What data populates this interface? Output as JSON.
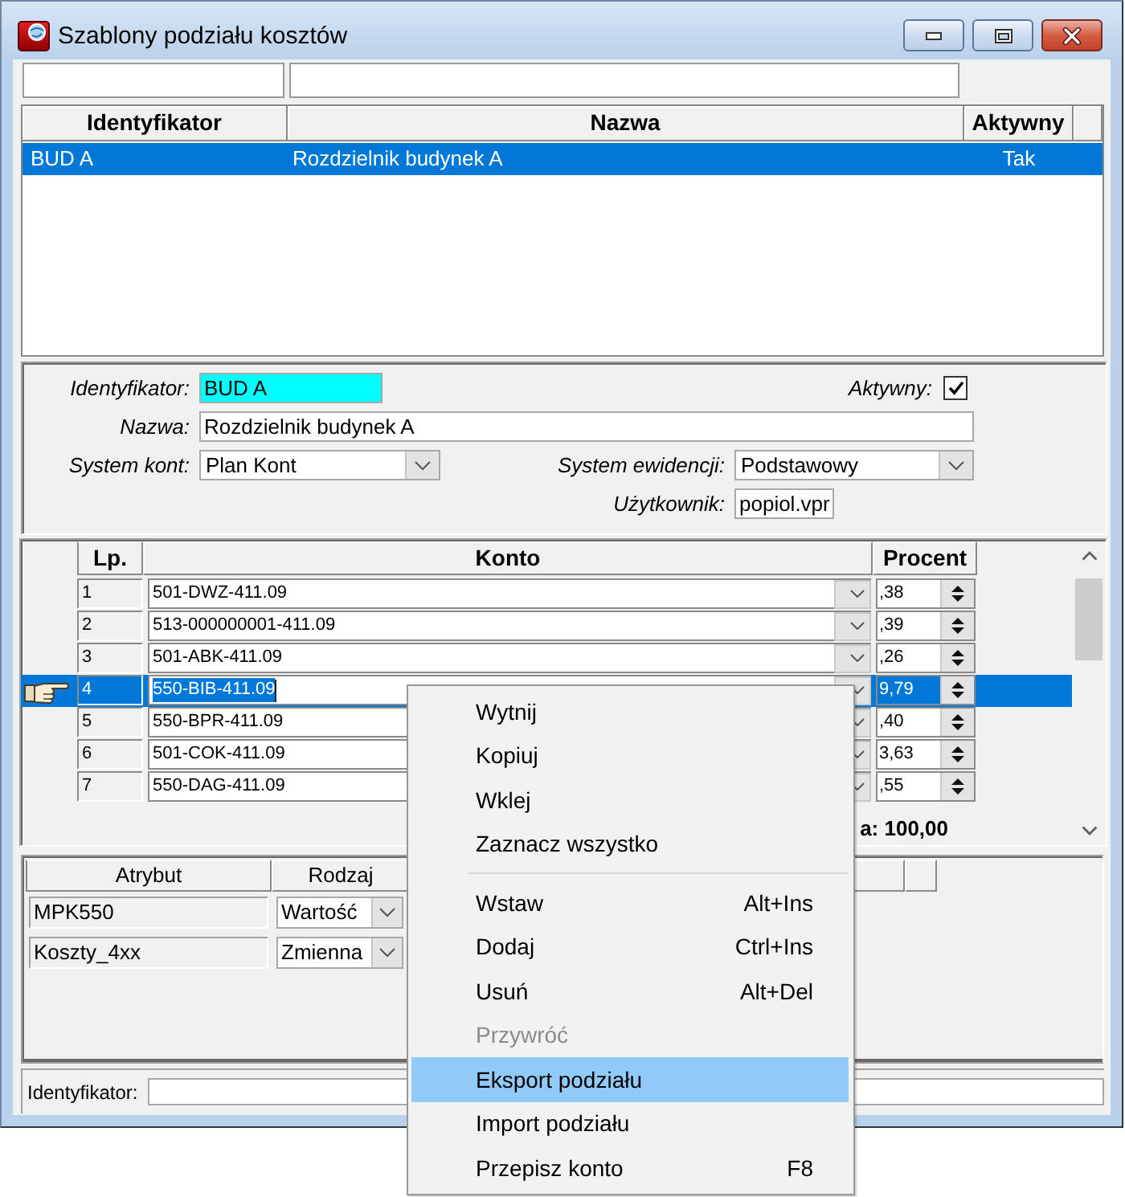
{
  "window": {
    "title": "Szablony podziału kosztów"
  },
  "templates": {
    "columns": [
      "Identyfikator",
      "Nazwa",
      "Aktywny"
    ],
    "rows": [
      {
        "identifier": "BUD A",
        "name": "Rozdzielnik budynek A",
        "active": "Tak",
        "selected": true
      }
    ]
  },
  "form": {
    "identifier": {
      "label": "Identyfikator:",
      "value": "BUD A"
    },
    "active": {
      "label": "Aktywny:",
      "checked": true
    },
    "name": {
      "label": "Nazwa:",
      "value": "Rozdzielnik budynek A"
    },
    "account_system": {
      "label": "System kont:",
      "value": "Plan Kont"
    },
    "record_system": {
      "label": "System ewidencji:",
      "value": "Podstawowy"
    },
    "user": {
      "label": "Użytkownik:",
      "value": "popiol.vpr"
    }
  },
  "split": {
    "columns": [
      "Lp.",
      "Konto",
      "Procent"
    ],
    "rows": [
      {
        "lp": "1",
        "account": "501-DWZ-411.09",
        "percent": ",38",
        "selected": false
      },
      {
        "lp": "2",
        "account": "513-000000001-411.09",
        "percent": ",39",
        "selected": false
      },
      {
        "lp": "3",
        "account": "501-ABK-411.09",
        "percent": ",26",
        "selected": false
      },
      {
        "lp": "4",
        "account": "550-BIB-411.09",
        "percent": "9,79",
        "selected": true
      },
      {
        "lp": "5",
        "account": "550-BPR-411.09",
        "percent": ",40",
        "selected": false
      },
      {
        "lp": "6",
        "account": "501-COK-411.09",
        "percent": "3,63",
        "selected": false
      },
      {
        "lp": "7",
        "account": "550-DAG-411.09",
        "percent": ",55",
        "selected": false
      }
    ],
    "total": "a: 100,00"
  },
  "attributes": {
    "columns": [
      "Atrybut",
      "Rodzaj"
    ],
    "rows": [
      {
        "attribute": "MPK550",
        "type": "Wartość"
      },
      {
        "attribute": "Koszty_4xx",
        "type": "Zmienna"
      }
    ]
  },
  "status_bar": {
    "label": "Identyfikator:"
  },
  "context_menu": {
    "items": [
      {
        "kind": "item",
        "label": "Wytnij",
        "disabled": false,
        "selected": false
      },
      {
        "kind": "item",
        "label": "Kopiuj",
        "disabled": false,
        "selected": false
      },
      {
        "kind": "item",
        "label": "Wklej",
        "disabled": false,
        "selected": false
      },
      {
        "kind": "item",
        "label": "Zaznacz wszystko",
        "disabled": false,
        "selected": false
      },
      {
        "kind": "separator"
      },
      {
        "kind": "item",
        "label": "Wstaw",
        "shortcut": "Alt+Ins",
        "disabled": false,
        "selected": false
      },
      {
        "kind": "item",
        "label": "Dodaj",
        "shortcut": "Ctrl+Ins",
        "disabled": false,
        "selected": false
      },
      {
        "kind": "item",
        "label": "Usuń",
        "shortcut": "Alt+Del",
        "disabled": false,
        "selected": false
      },
      {
        "kind": "item",
        "label": "Przywróć",
        "disabled": true,
        "selected": false
      },
      {
        "kind": "item",
        "label": "Eksport podziału",
        "disabled": false,
        "selected": true
      },
      {
        "kind": "item",
        "label": "Import podziału",
        "disabled": false,
        "selected": false
      },
      {
        "kind": "item",
        "label": "Przepisz konto",
        "shortcut": "F8",
        "disabled": false,
        "selected": false
      }
    ]
  }
}
